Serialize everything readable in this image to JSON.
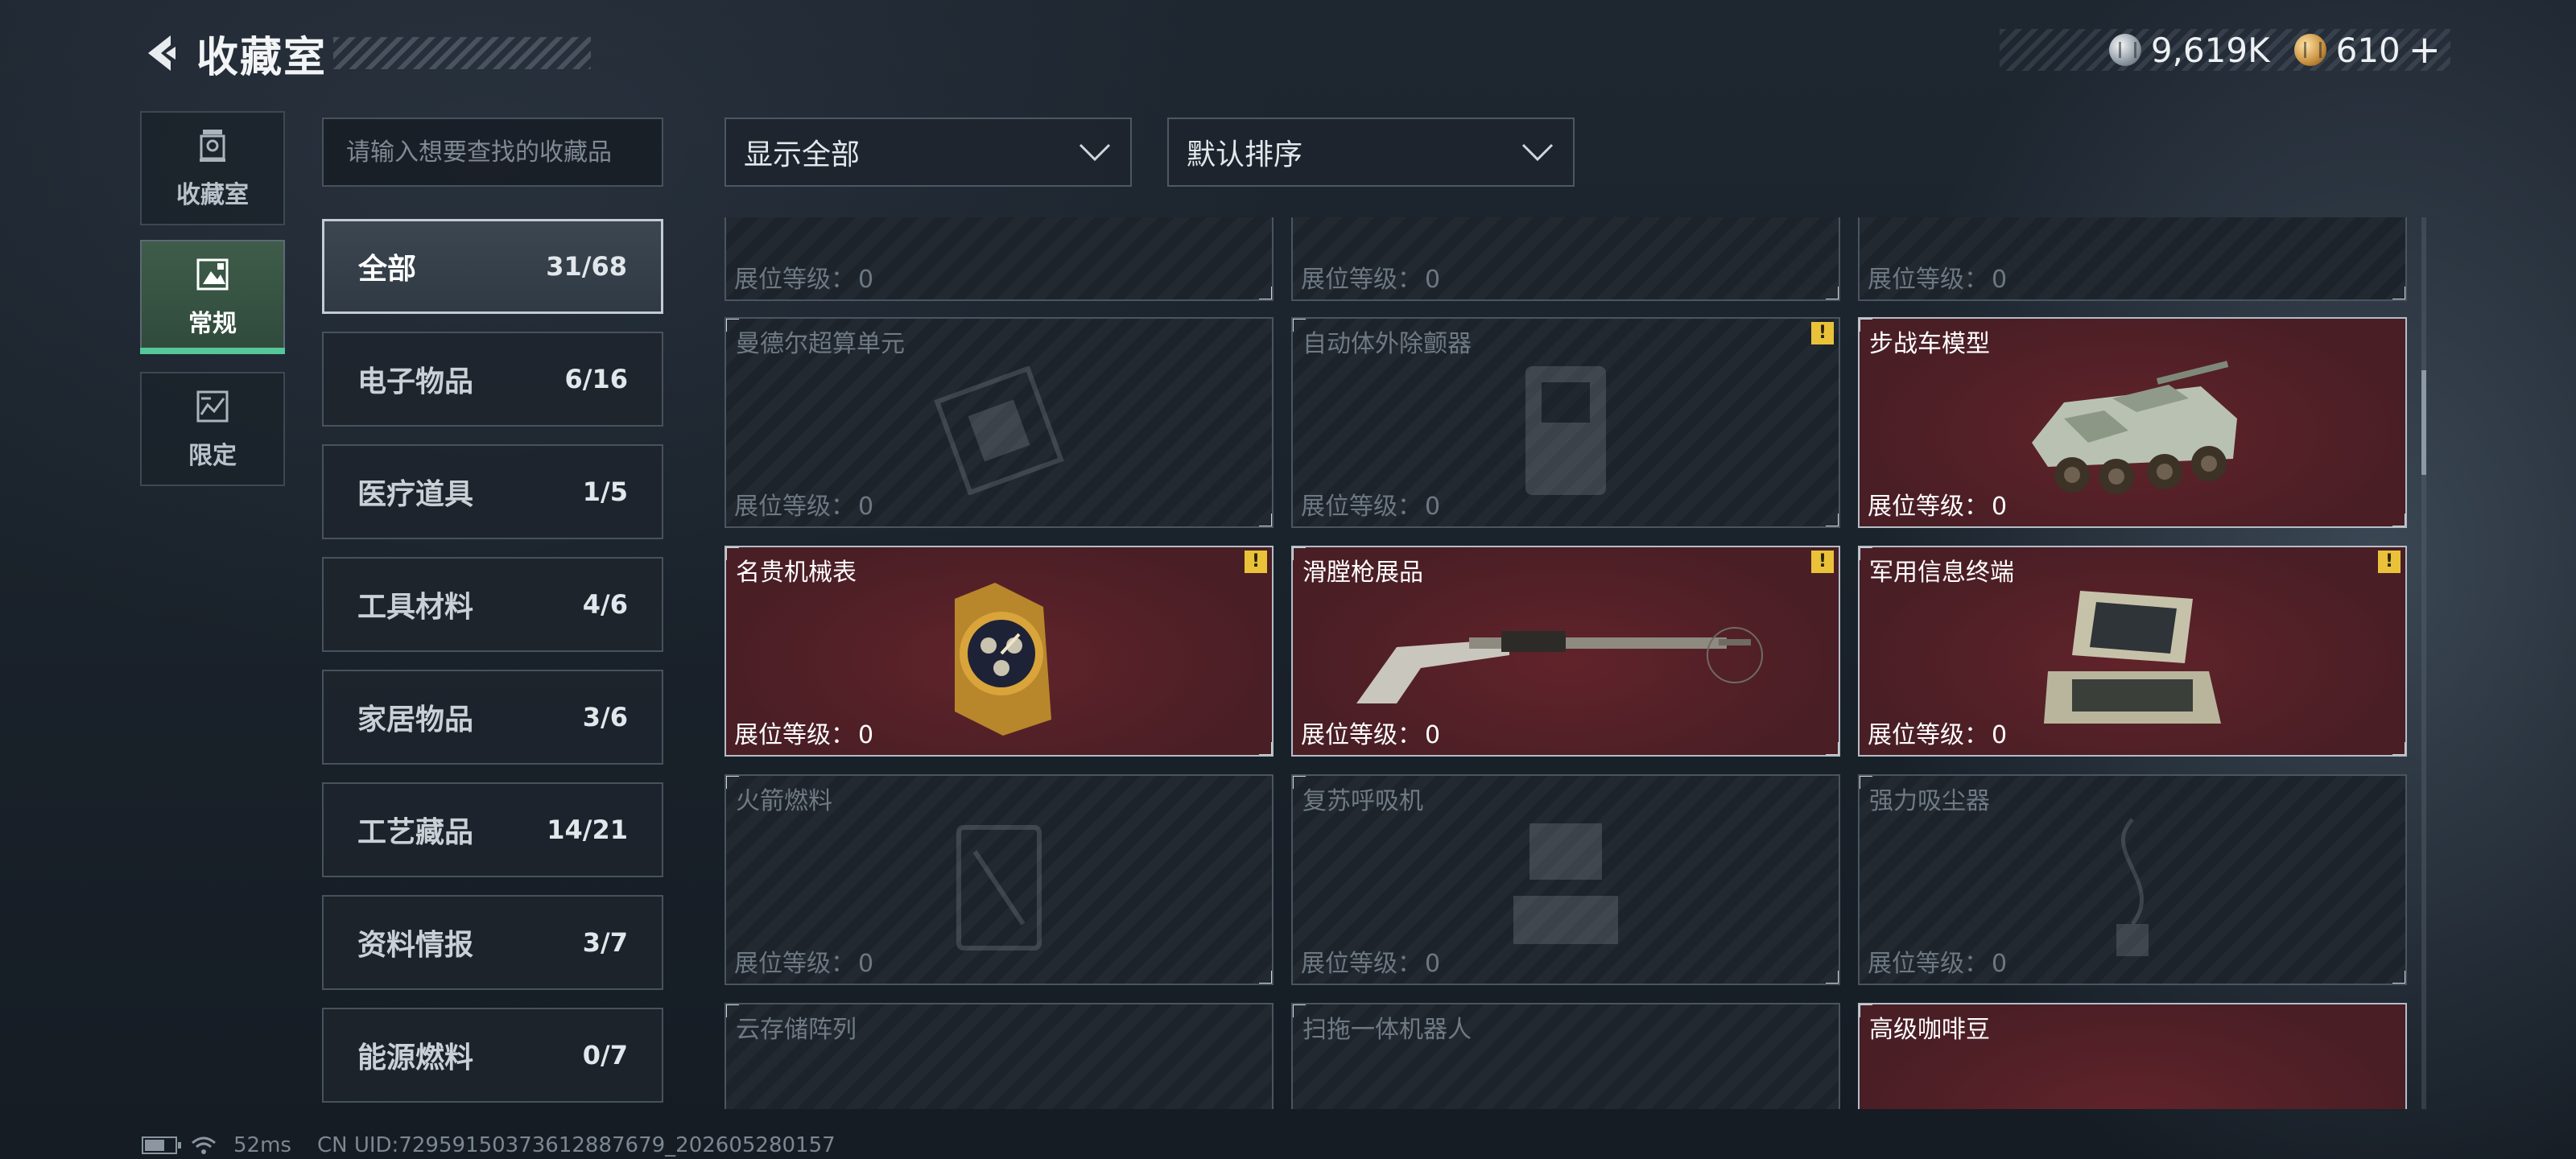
{
  "header": {
    "title": "收藏室",
    "silver_amount": "9,619K",
    "gold_amount": "610",
    "gold_plus": "+"
  },
  "rail": [
    {
      "label": "收藏室",
      "icon": "collection-room-icon"
    },
    {
      "label": "常规",
      "icon": "regular-icon",
      "active": true
    },
    {
      "label": "限定",
      "icon": "limited-icon"
    }
  ],
  "search": {
    "placeholder": "请输入想要查找的收藏品"
  },
  "filters": {
    "display": "显示全部",
    "sort": "默认排序"
  },
  "categories": [
    {
      "label": "全部",
      "count": "31/68",
      "active": true
    },
    {
      "label": "电子物品",
      "count": "6/16"
    },
    {
      "label": "医疗道具",
      "count": "1/5"
    },
    {
      "label": "工具材料",
      "count": "4/6"
    },
    {
      "label": "家居物品",
      "count": "3/6"
    },
    {
      "label": "工艺藏品",
      "count": "14/21"
    },
    {
      "label": "资料情报",
      "count": "3/7"
    },
    {
      "label": "能源燃料",
      "count": "0/7"
    }
  ],
  "level_label": "展位等级：",
  "items": [
    {
      "name": "",
      "level": "0",
      "collected": false,
      "alert": false,
      "icon": "generic-item-icon"
    },
    {
      "name": "",
      "level": "0",
      "collected": false,
      "alert": false,
      "icon": "generic-item-icon"
    },
    {
      "name": "",
      "level": "0",
      "collected": false,
      "alert": false,
      "icon": "generic-item-icon"
    },
    {
      "name": "曼德尔超算单元",
      "level": "0",
      "collected": false,
      "alert": false,
      "icon": "supercomputer-unit-icon"
    },
    {
      "name": "自动体外除颤器",
      "level": "0",
      "collected": false,
      "alert": true,
      "icon": "defibrillator-icon"
    },
    {
      "name": "步战车模型",
      "level": "0",
      "collected": true,
      "alert": false,
      "icon": "ifv-model-icon"
    },
    {
      "name": "名贵机械表",
      "level": "0",
      "collected": true,
      "alert": true,
      "icon": "mechanical-watch-icon"
    },
    {
      "name": "滑膛枪展品",
      "level": "0",
      "collected": true,
      "alert": true,
      "icon": "musket-icon"
    },
    {
      "name": "军用信息终端",
      "level": "0",
      "collected": true,
      "alert": true,
      "icon": "military-terminal-icon"
    },
    {
      "name": "火箭燃料",
      "level": "0",
      "collected": false,
      "alert": false,
      "icon": "rocket-fuel-icon"
    },
    {
      "name": "复苏呼吸机",
      "level": "0",
      "collected": false,
      "alert": false,
      "icon": "ventilator-icon"
    },
    {
      "name": "强力吸尘器",
      "level": "0",
      "collected": false,
      "alert": false,
      "icon": "vacuum-cleaner-icon"
    },
    {
      "name": "云存储阵列",
      "level": "",
      "collected": false,
      "alert": false,
      "icon": "cloud-storage-icon"
    },
    {
      "name": "扫拖一体机器人",
      "level": "",
      "collected": false,
      "alert": false,
      "icon": "robot-vacuum-icon"
    },
    {
      "name": "高级咖啡豆",
      "level": "",
      "collected": true,
      "alert": false,
      "icon": "coffee-beans-icon"
    }
  ],
  "alert_symbol": "!",
  "footer": {
    "ping": "52ms",
    "uid": "CN UID:7295915037361288767​9_202605280157"
  }
}
